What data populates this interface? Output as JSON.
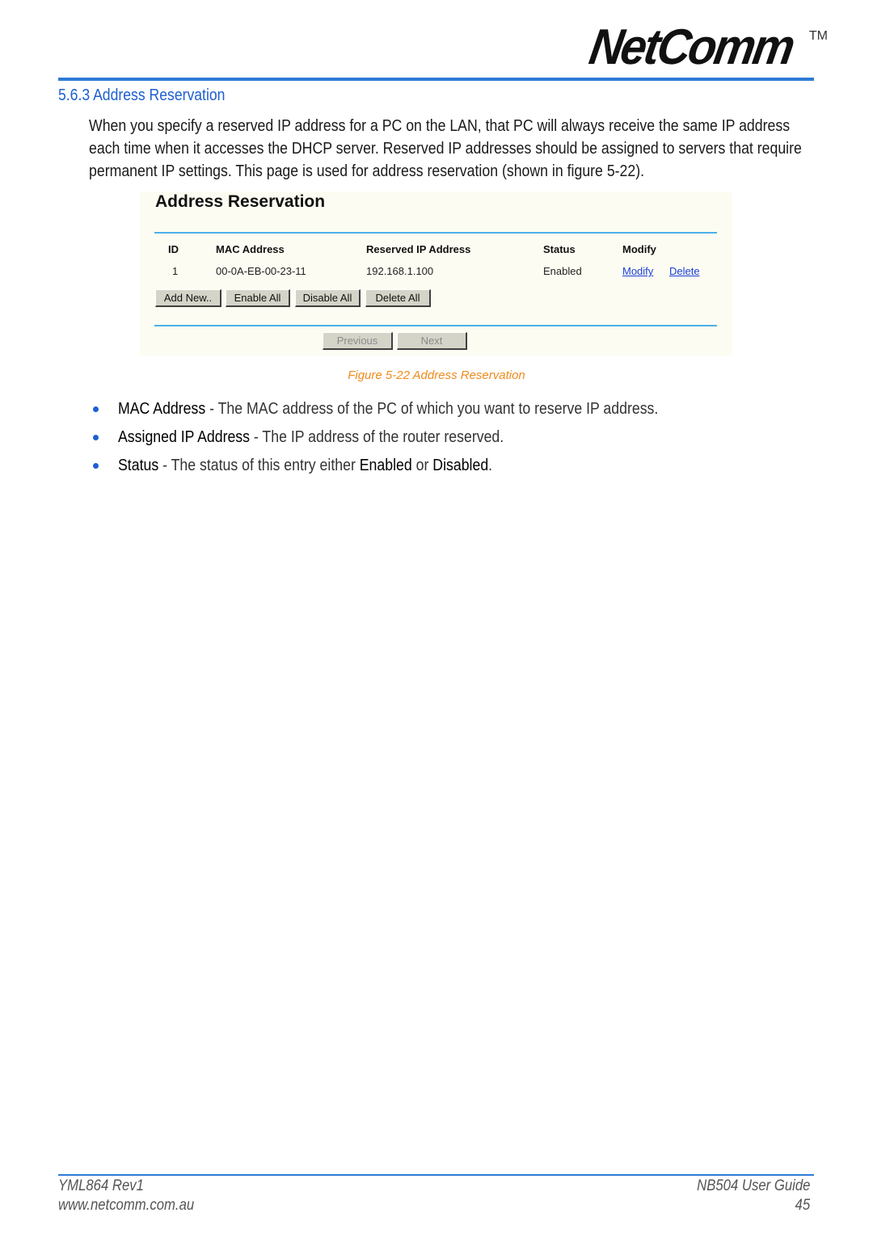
{
  "header": {
    "logo_text": "NetComm",
    "logo_tm": "TM"
  },
  "section": {
    "title": "5.6.3 Address Reservation",
    "intro": "When you specify a reserved IP address for a PC on the LAN, that PC will always receive the same IP address each time when it accesses the DHCP server. Reserved IP addresses should be assigned to servers that require permanent IP settings. This page is used for address reservation (shown in figure 5-22)."
  },
  "figure": {
    "panel_title": "Address Reservation",
    "columns": [
      "ID",
      "MAC Address",
      "Reserved IP Address",
      "Status",
      "Modify"
    ],
    "rows": [
      {
        "id": "1",
        "mac": "00-0A-EB-00-23-11",
        "ip": "192.168.1.100",
        "status": "Enabled",
        "modify_link": "Modify",
        "delete_link": "Delete"
      }
    ],
    "buttons": {
      "add_new": "Add New..",
      "enable_all": "Enable All",
      "disable_all": "Disable All",
      "delete_all": "Delete All",
      "previous": "Previous",
      "next": "Next"
    },
    "caption": "Figure 5-22 Address Reservation"
  },
  "bullets": [
    {
      "term": "MAC Address",
      "desc": " - The MAC address of the PC of which you want to reserve IP address."
    },
    {
      "term": "Assigned IP Address",
      "desc": " - The IP address of the router reserved."
    },
    {
      "term": "Status",
      "desc_pre": " - The status of this entry either ",
      "opt1": "Enabled",
      "mid": " or ",
      "opt2": "Disabled",
      "end": "."
    }
  ],
  "footer": {
    "doc_id": "YML864 Rev1",
    "website": "www.netcomm.com.au",
    "guide": "NB504 User Guide",
    "page": "45"
  },
  "colors": {
    "accent_blue": "#1d5fd1",
    "rule_blue": "#2e7bd6",
    "caption_orange": "#f08a1c",
    "panel_bg": "#fcfcf2",
    "panel_rule": "#4cb0ea"
  }
}
